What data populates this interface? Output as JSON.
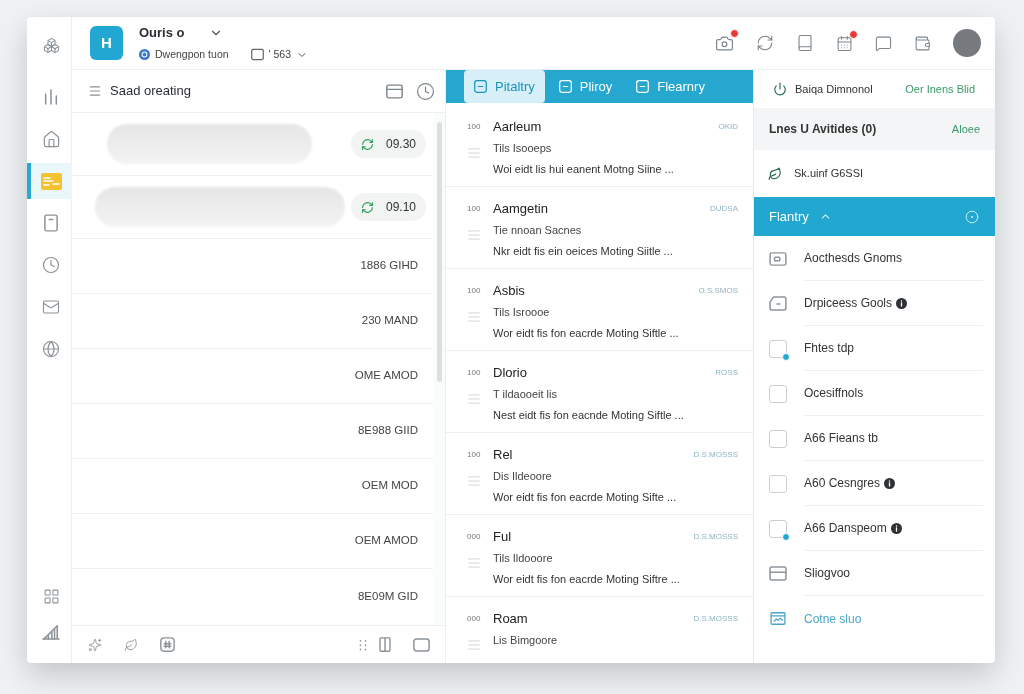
{
  "rail": {
    "top": [
      {
        "kind": "boxes",
        "selected": false
      },
      {
        "kind": "bars",
        "selected": false
      },
      {
        "kind": "home",
        "selected": false
      },
      {
        "kind": "cards",
        "selected": true
      },
      {
        "kind": "document",
        "selected": false
      },
      {
        "kind": "clock",
        "selected": false
      },
      {
        "kind": "mail",
        "selected": false
      },
      {
        "kind": "globe",
        "selected": false
      }
    ],
    "bottom": [
      {
        "kind": "grid",
        "selected": false
      },
      {
        "kind": "chart",
        "selected": false
      }
    ]
  },
  "header": {
    "logo": "H",
    "title": "Ouris o",
    "subtitle": "Dwengpon tuon",
    "selector": "' 563"
  },
  "toolbar": [
    {
      "kind": "camera",
      "badge": true
    },
    {
      "kind": "refresh",
      "badge": false
    },
    {
      "kind": "book",
      "badge": false
    },
    {
      "kind": "calendar",
      "badge": true
    },
    {
      "kind": "message",
      "badge": false
    },
    {
      "kind": "wallet",
      "badge": false
    }
  ],
  "list_panel": {
    "title": "Saad oreating",
    "rows": [
      {
        "kind": "chip",
        "time": "09.30"
      },
      {
        "kind": "chip",
        "time": "09.10"
      },
      {
        "kind": "plain",
        "text": "1886 GIHD"
      },
      {
        "kind": "plain",
        "text": "230 MAND"
      },
      {
        "kind": "plain",
        "text": "OME AMOD"
      },
      {
        "kind": "plain",
        "text": "8E988 GIID"
      },
      {
        "kind": "plain",
        "text": "OEM MOD"
      },
      {
        "kind": "plain",
        "text": "OEM AMOD"
      },
      {
        "kind": "plain",
        "text": "8E09M GID"
      }
    ]
  },
  "middle": {
    "tabs": [
      {
        "label": "Pitaltry",
        "selected": true
      },
      {
        "label": "Pliroy",
        "selected": false
      },
      {
        "label": "Flearnry",
        "selected": false
      }
    ],
    "cards": [
      {
        "code": "100",
        "title": "Aarleum",
        "date": "OKID",
        "subtitle": "Tils Isooeps",
        "description": "Woi eidt lis hui eanent Motng Siine ..."
      },
      {
        "code": "100",
        "title": "Aamgetin",
        "date": "DUDSA",
        "subtitle": "Tie nnoan Sacnes",
        "description": "Nkr eidt fis ein oeices Moting Siitle ..."
      },
      {
        "code": "100",
        "title": "Asbis",
        "date": "O.S.SMOS",
        "subtitle": "Tils Isroooe",
        "description": "Wor eidt fis fon eacrde Moting Siftle ..."
      },
      {
        "code": "100",
        "title": "Dlorio",
        "date": "ROSS",
        "subtitle": "T ildaooeit lis",
        "description": "Nest eidt fis fon eacnde Moting Siftle ..."
      },
      {
        "code": "100",
        "title": "Rel",
        "date": "D.S.MOSSS",
        "subtitle": "Dis Ildeoore",
        "description": "Wor eidt fis fon eacrde Moting Sifte ..."
      },
      {
        "code": "000",
        "title": "Ful",
        "date": "D.S.MOSSS",
        "subtitle": "Tils Ildooore",
        "description": "Wor eidt fis fon eacrde Moting Siftre ..."
      },
      {
        "code": "000",
        "title": "Roam",
        "date": "D.S.MOSSS",
        "subtitle": "Lis Bimgoore"
      }
    ]
  },
  "right_panel": {
    "header": {
      "label": "Baiqa Dimnonol",
      "link": "Oer Inens Blid"
    },
    "section": {
      "title": "Lnes U Avitides (0)",
      "action": "Aloee"
    },
    "status_row": "Sk.uinf G6SSI",
    "group": {
      "label": "Flantry",
      "expanded": true,
      "items": [
        {
          "kind": "card",
          "label": "Aocthesds Gnoms",
          "info": false
        },
        {
          "kind": "tag",
          "label": "Drpiceess Gools",
          "info": true
        },
        {
          "kind": "checkbox",
          "label": "Fhtes tdp",
          "checked": false,
          "dot": true,
          "info": false
        },
        {
          "kind": "checkbox",
          "label": "Ocesiffnols",
          "checked": false,
          "dot": false,
          "info": false
        },
        {
          "kind": "checkbox",
          "label": "A66 Fieans tb",
          "checked": false,
          "dot": false,
          "info": false
        },
        {
          "kind": "checkbox",
          "label": "A60 Cesngres",
          "checked": false,
          "dot": false,
          "info": true
        },
        {
          "kind": "checkbox",
          "label": "A66 Danspeom",
          "checked": false,
          "dot": true,
          "info": true
        },
        {
          "kind": "window",
          "label": "Sliogvoo",
          "info": false
        },
        {
          "kind": "link",
          "label": "Cotne sluo",
          "info": false
        }
      ]
    }
  }
}
